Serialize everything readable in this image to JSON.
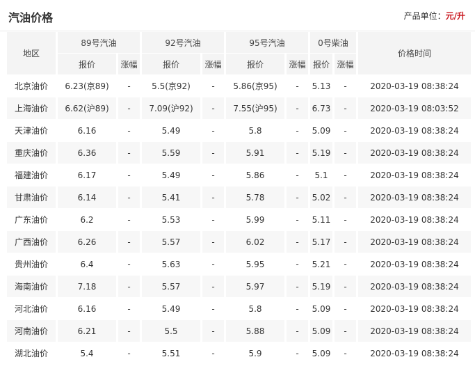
{
  "header": {
    "title": "汽油价格",
    "unit_label": "产品单位：",
    "unit_value": "元/升"
  },
  "table": {
    "region_header": "地区",
    "groups": [
      "89号汽油",
      "92号汽油",
      "95号汽油",
      "0号柴油"
    ],
    "sub_price": "报价",
    "sub_change": "涨幅",
    "time_header": "价格时间",
    "rows": [
      {
        "region": "北京油价",
        "p89": "6.23(京89)",
        "c89": "-",
        "p92": "5.5(京92)",
        "c92": "-",
        "p95": "5.86(京95)",
        "c95": "-",
        "p0": "5.13",
        "c0": "-",
        "time": "2020-03-19 08:38:24"
      },
      {
        "region": "上海油价",
        "p89": "6.62(沪89)",
        "c89": "-",
        "p92": "7.09(沪92)",
        "c92": "-",
        "p95": "7.55(沪95)",
        "c95": "-",
        "p0": "6.73",
        "c0": "-",
        "time": "2020-03-19 08:03:52"
      },
      {
        "region": "天津油价",
        "p89": "6.16",
        "c89": "-",
        "p92": "5.49",
        "c92": "-",
        "p95": "5.8",
        "c95": "-",
        "p0": "5.09",
        "c0": "-",
        "time": "2020-03-19 08:38:24"
      },
      {
        "region": "重庆油价",
        "p89": "6.36",
        "c89": "-",
        "p92": "5.59",
        "c92": "-",
        "p95": "5.91",
        "c95": "-",
        "p0": "5.19",
        "c0": "-",
        "time": "2020-03-19 08:38:24"
      },
      {
        "region": "福建油价",
        "p89": "6.17",
        "c89": "-",
        "p92": "5.49",
        "c92": "-",
        "p95": "5.86",
        "c95": "-",
        "p0": "5.1",
        "c0": "-",
        "time": "2020-03-19 08:38:24"
      },
      {
        "region": "甘肃油价",
        "p89": "6.14",
        "c89": "-",
        "p92": "5.41",
        "c92": "-",
        "p95": "5.78",
        "c95": "-",
        "p0": "5.02",
        "c0": "-",
        "time": "2020-03-19 08:38:24"
      },
      {
        "region": "广东油价",
        "p89": "6.2",
        "c89": "-",
        "p92": "5.53",
        "c92": "-",
        "p95": "5.99",
        "c95": "-",
        "p0": "5.11",
        "c0": "-",
        "time": "2020-03-19 08:38:24"
      },
      {
        "region": "广西油价",
        "p89": "6.26",
        "c89": "-",
        "p92": "5.57",
        "c92": "-",
        "p95": "6.02",
        "c95": "-",
        "p0": "5.17",
        "c0": "-",
        "time": "2020-03-19 08:38:24"
      },
      {
        "region": "贵州油价",
        "p89": "6.4",
        "c89": "-",
        "p92": "5.63",
        "c92": "-",
        "p95": "5.95",
        "c95": "-",
        "p0": "5.21",
        "c0": "-",
        "time": "2020-03-19 08:38:24"
      },
      {
        "region": "海南油价",
        "p89": "7.18",
        "c89": "-",
        "p92": "5.57",
        "c92": "-",
        "p95": "5.97",
        "c95": "-",
        "p0": "5.19",
        "c0": "-",
        "time": "2020-03-19 08:38:24"
      },
      {
        "region": "河北油价",
        "p89": "6.16",
        "c89": "-",
        "p92": "5.49",
        "c92": "-",
        "p95": "5.8",
        "c95": "-",
        "p0": "5.09",
        "c0": "-",
        "time": "2020-03-19 08:38:24"
      },
      {
        "region": "河南油价",
        "p89": "6.21",
        "c89": "-",
        "p92": "5.5",
        "c92": "-",
        "p95": "5.88",
        "c95": "-",
        "p0": "5.09",
        "c0": "-",
        "time": "2020-03-19 08:38:24"
      },
      {
        "region": "湖北油价",
        "p89": "5.4",
        "c89": "-",
        "p92": "5.51",
        "c92": "-",
        "p95": "5.9",
        "c95": "-",
        "p0": "5.09",
        "c0": "-",
        "time": "2020-03-19 08:38:24"
      }
    ]
  },
  "colors": {
    "accent": "#c9171e",
    "header_bg": "#f4f4f4",
    "stripe_bg": "#f7f7f7"
  }
}
